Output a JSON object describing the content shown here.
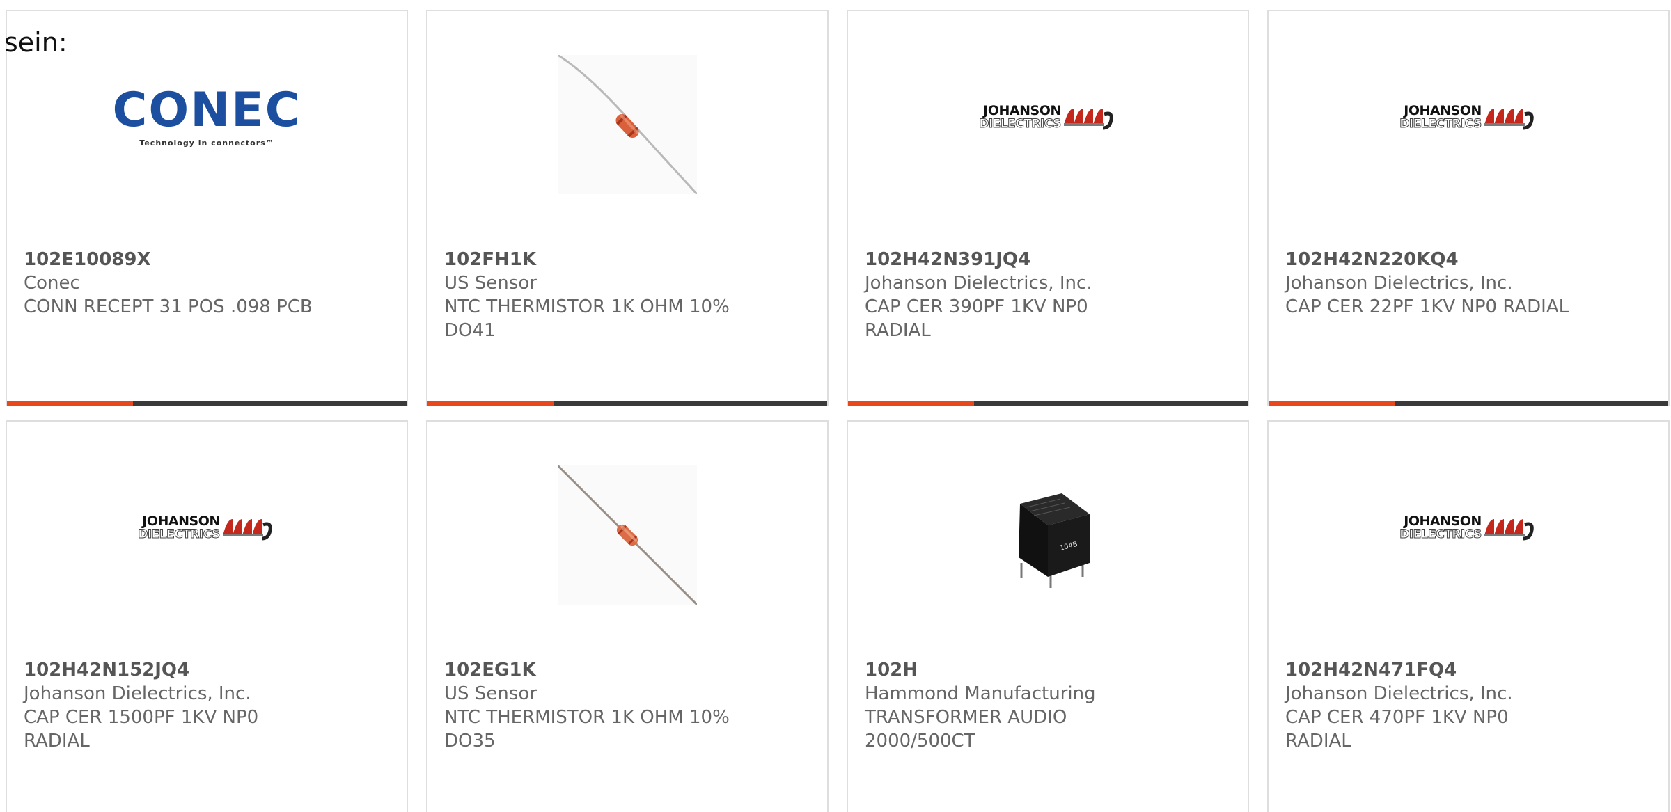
{
  "intro_text": "sein:",
  "colors": {
    "accent": "#e8481c",
    "bar": "#3a3a3a",
    "conec_blue": "#1d4fa0",
    "johanson_red": "#c4281c"
  },
  "products": [
    {
      "part_number": "102E10089X",
      "manufacturer": "Conec",
      "description": "CONN RECEPT 31 POS .098 PCB",
      "image": "conec-logo",
      "logo_word": "CONEC",
      "logo_tagline": "Technology in connectors™"
    },
    {
      "part_number": "102FH1K",
      "manufacturer": "US Sensor",
      "description": "NTC THERMISTOR 1K OHM 10% DO41",
      "image": "thermistor-photo"
    },
    {
      "part_number": "102H42N391JQ4",
      "manufacturer": "Johanson Dielectrics, Inc.",
      "description": "CAP CER 390PF 1KV NP0 RADIAL",
      "image": "johanson-logo",
      "logo_line1": "JOHANSON",
      "logo_line2": "DIELECTRICS"
    },
    {
      "part_number": "102H42N220KQ4",
      "manufacturer": "Johanson Dielectrics, Inc.",
      "description": "CAP CER 22PF 1KV NP0 RADIAL",
      "image": "johanson-logo",
      "logo_line1": "JOHANSON",
      "logo_line2": "DIELECTRICS"
    },
    {
      "part_number": "102H42N152JQ4",
      "manufacturer": "Johanson Dielectrics, Inc.",
      "description": "CAP CER 1500PF 1KV NP0 RADIAL",
      "image": "johanson-logo",
      "logo_line1": "JOHANSON",
      "logo_line2": "DIELECTRICS"
    },
    {
      "part_number": "102EG1K",
      "manufacturer": "US Sensor",
      "description": "NTC THERMISTOR 1K OHM 10% DO35",
      "image": "thermistor-photo"
    },
    {
      "part_number": "102H",
      "manufacturer": "Hammond Manufacturing",
      "description": "TRANSFORMER AUDIO 2000/500CT",
      "image": "transformer-photo",
      "marking": "104B"
    },
    {
      "part_number": "102H42N471FQ4",
      "manufacturer": "Johanson Dielectrics, Inc.",
      "description": "CAP CER 470PF 1KV NP0 RADIAL",
      "image": "johanson-logo",
      "logo_line1": "JOHANSON",
      "logo_line2": "DIELECTRICS"
    }
  ]
}
